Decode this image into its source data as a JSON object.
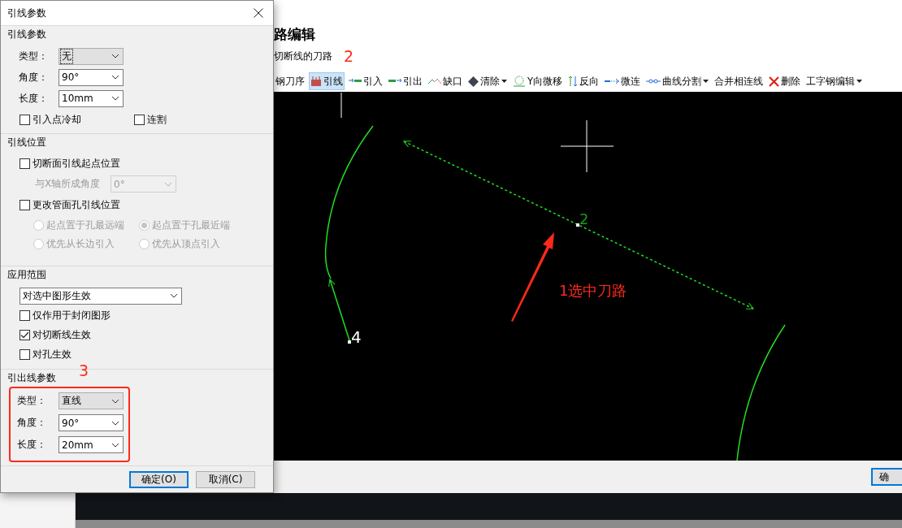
{
  "background_window": {
    "heading": "路编辑",
    "subtitle": "切断线的刀路",
    "step_mark": "2",
    "toolbar": [
      {
        "label": "钢刀序",
        "selected": false,
        "dropdown": false
      },
      {
        "label": "引线",
        "selected": true,
        "dropdown": false
      },
      {
        "label": "引入",
        "selected": false,
        "dropdown": false
      },
      {
        "label": "引出",
        "selected": false,
        "dropdown": false
      },
      {
        "label": "缺口",
        "selected": false,
        "dropdown": false
      },
      {
        "label": "清除",
        "selected": false,
        "dropdown": true
      },
      {
        "label": "Y向微移",
        "selected": false,
        "dropdown": false
      },
      {
        "label": "反向",
        "selected": false,
        "dropdown": false
      },
      {
        "label": "微连",
        "selected": false,
        "dropdown": false
      },
      {
        "label": "曲线分割",
        "selected": false,
        "dropdown": true
      },
      {
        "label": "合并相连线",
        "selected": false,
        "dropdown": false
      },
      {
        "label": "删除",
        "selected": false,
        "dropdown": false
      },
      {
        "label": "工字钢编辑",
        "selected": false,
        "dropdown": true
      }
    ],
    "canvas": {
      "point_labels": [
        "4",
        "2"
      ],
      "annotation": "1选中刀路"
    },
    "footer_button": "确"
  },
  "dialog": {
    "title": "引线参数",
    "sections": [
      {
        "title": "引线参数",
        "highlight": false,
        "items": [
          {
            "kind": "select",
            "label": "类型：",
            "value": "无",
            "editable": false,
            "disabled": false,
            "focused": true
          },
          {
            "kind": "select",
            "label": "角度：",
            "value": "90°",
            "editable": true,
            "disabled": false,
            "focused": false
          },
          {
            "kind": "select",
            "label": "长度：",
            "value": "10mm",
            "editable": true,
            "disabled": false,
            "focused": false
          },
          {
            "kind": "checkrow",
            "options": [
              {
                "label": "引入点冷却",
                "checked": false
              },
              {
                "label": "连割",
                "checked": false
              }
            ]
          }
        ]
      },
      {
        "title": "引线位置",
        "highlight": false,
        "items": [
          {
            "kind": "checkbox",
            "label": "切断面引线起点位置",
            "checked": false
          },
          {
            "kind": "subselect",
            "label": "与X轴所成角度",
            "value": "0°",
            "editable": true,
            "disabled": true,
            "focused": false
          },
          {
            "kind": "checkbox",
            "label": "更改管面孔引线位置",
            "checked": false
          },
          {
            "kind": "radios",
            "disabled": true,
            "options": [
              {
                "label": "起点置于孔最远端",
                "selected": false
              },
              {
                "label": "起点置于孔最近端",
                "selected": true
              },
              {
                "label": "优先从长边引入",
                "selected": false
              },
              {
                "label": "优先从顶点引入",
                "selected": false
              }
            ]
          }
        ]
      },
      {
        "title": "应用范围",
        "highlight": false,
        "items": [
          {
            "kind": "wideselect",
            "value": "对选中图形生效",
            "editable": true,
            "disabled": false,
            "focused": false
          },
          {
            "kind": "checkbox",
            "label": "仅作用于封闭图形",
            "checked": false
          },
          {
            "kind": "checkbox",
            "label": "对切断线生效",
            "checked": true
          },
          {
            "kind": "checkbox",
            "label": "对孔生效",
            "checked": false
          }
        ]
      },
      {
        "title": "引出线参数",
        "highlight": true,
        "step_mark": "3",
        "items": [
          {
            "kind": "select",
            "label": "类型：",
            "value": "直线",
            "editable": false,
            "disabled": false,
            "focused": false
          },
          {
            "kind": "select",
            "label": "角度：",
            "value": "90°",
            "editable": true,
            "disabled": false,
            "focused": false
          },
          {
            "kind": "select",
            "label": "长度：",
            "value": "20mm",
            "editable": true,
            "disabled": false,
            "focused": false
          }
        ]
      }
    ],
    "buttons": [
      {
        "label": "确定(O)",
        "default": true
      },
      {
        "label": "取消(C)",
        "default": false
      }
    ]
  }
}
